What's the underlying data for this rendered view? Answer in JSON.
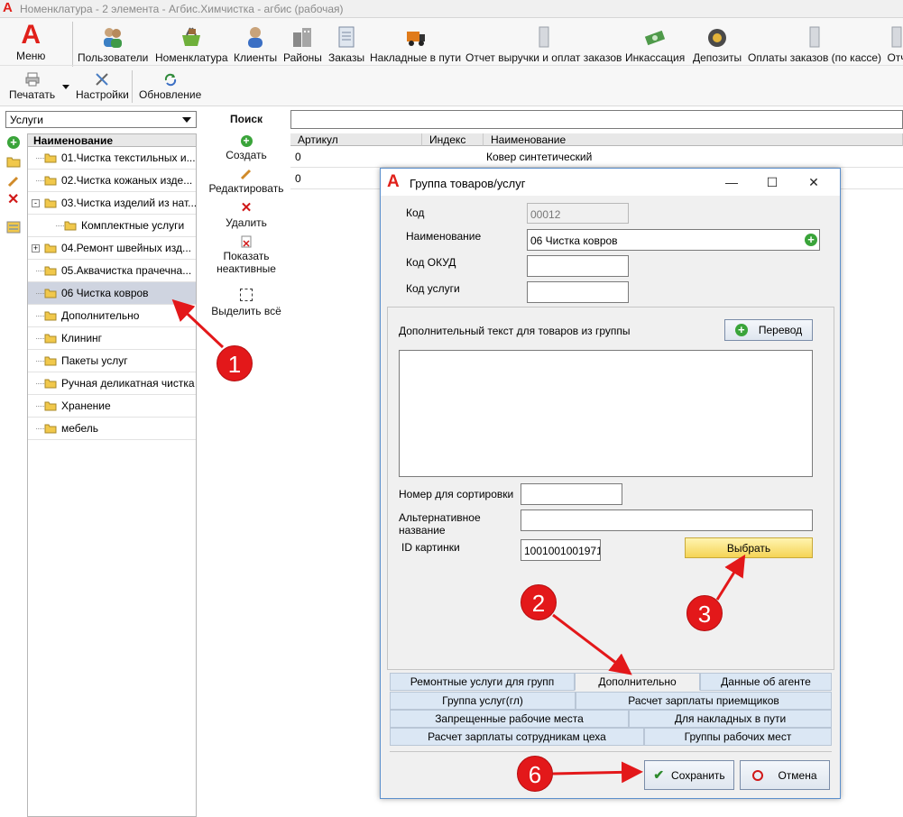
{
  "window": {
    "title": "Номенклатура - 2 элемента - Агбис.Химчистка - агбис (рабочая)"
  },
  "ribbon": {
    "menu_label": "Меню",
    "items": [
      {
        "label": "Пользователи",
        "icon": "users-icon"
      },
      {
        "label": "Номенклатура",
        "icon": "basket-icon"
      },
      {
        "label": "Клиенты",
        "icon": "client-icon"
      },
      {
        "label": "Районы",
        "icon": "district-icon"
      },
      {
        "label": "Заказы",
        "icon": "orders-icon"
      },
      {
        "label": "Накладные в пути",
        "icon": "truck-icon"
      },
      {
        "label": "Отчет выручки и оплат заказов",
        "icon": "report-icon"
      },
      {
        "label": "Инкассация",
        "icon": "money-icon"
      },
      {
        "label": "Депозиты",
        "icon": "deposit-icon"
      },
      {
        "label": "Оплаты заказов (по кассе)",
        "icon": "cash-icon"
      },
      {
        "label": "Отч",
        "icon": "report-icon"
      }
    ],
    "print_label": "Печатать",
    "settings_label": "Настройки",
    "refresh_label": "Обновление"
  },
  "filter": {
    "selected": "Услуги"
  },
  "tree": {
    "header": "Наименование",
    "items": [
      {
        "label": "01.Чистка текстильных и..."
      },
      {
        "label": "02.Чистка кожаных изде..."
      },
      {
        "label": "03.Чистка изделий из нат..."
      },
      {
        "label": "Комплектные услуги"
      },
      {
        "label": "04.Ремонт швейных изд..."
      },
      {
        "label": "05.Аквачистка прачечна..."
      },
      {
        "label": "06 Чистка ковров"
      },
      {
        "label": "Дополнительно"
      },
      {
        "label": "Клининг"
      },
      {
        "label": "Пакеты услуг"
      },
      {
        "label": "Ручная деликатная чистка"
      },
      {
        "label": "Хранение"
      },
      {
        "label": "мебель"
      }
    ]
  },
  "actions": {
    "search_label": "Поиск",
    "create": "Создать",
    "edit": "Редактировать",
    "delete": "Удалить",
    "show_inactive": "Показать неактивные",
    "select_all": "Выделить всё"
  },
  "grid": {
    "columns": [
      "Артикул",
      "Индекс",
      "Наименование"
    ],
    "rows": [
      {
        "article": "0",
        "index": "",
        "name": "Ковер синтетический"
      },
      {
        "article": "0",
        "index": "",
        "name": ""
      }
    ]
  },
  "dialog": {
    "title": "Группа товаров/услуг",
    "code_label": "Код",
    "code_value": "00012",
    "name_label": "Наименование",
    "name_value": "06 Чистка ковров",
    "okud_label": "Код ОКУД",
    "okud_value": "",
    "service_code_label": "Код услуги",
    "service_code_value": "",
    "extra_text_label": "Дополнительный текст для товаров из группы",
    "translate_label": "Перевод",
    "sort_label": "Номер для сортировки",
    "sort_value": "",
    "alt_name_label": "Альтернативное название",
    "alt_name_value": "",
    "image_id_label": "ID картинки",
    "image_id_value": "1001001001971",
    "choose_label": "Выбрать",
    "tabs": [
      "Ремонтные услуги для групп",
      "Дополнительно",
      "Данные об агенте",
      "Группа услуг(гл)",
      "Расчет зарплаты приемщиков",
      "Запрещенные рабочие места",
      "Для накладных в пути",
      "Расчет зарплаты сотрудникам цеха",
      "Группы рабочих мест"
    ],
    "save_label": "Сохранить",
    "cancel_label": "Отмена"
  },
  "annotations": {
    "markers": [
      "1",
      "2",
      "3",
      "6"
    ],
    "color": "#e3181a"
  }
}
